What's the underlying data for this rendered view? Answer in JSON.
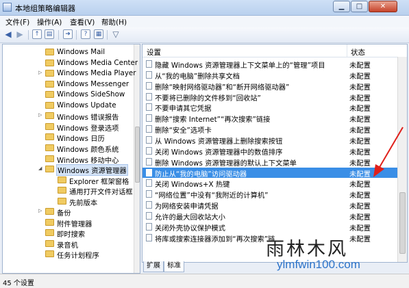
{
  "window": {
    "title": "本地组策略编辑器"
  },
  "menu": {
    "items": [
      "文件(F)",
      "操作(A)",
      "查看(V)",
      "帮助(H)"
    ]
  },
  "tree": {
    "items": [
      {
        "label": "Windows Mail",
        "level": 1,
        "arrow": ""
      },
      {
        "label": "Windows Media Center",
        "level": 1,
        "arrow": ""
      },
      {
        "label": "Windows Media Player",
        "level": 1,
        "arrow": "▷"
      },
      {
        "label": "Windows Messenger",
        "level": 1,
        "arrow": ""
      },
      {
        "label": "Windows SideShow",
        "level": 1,
        "arrow": ""
      },
      {
        "label": "Windows Update",
        "level": 1,
        "arrow": ""
      },
      {
        "label": "Windows 错误报告",
        "level": 1,
        "arrow": "▷"
      },
      {
        "label": "Windows 登录选项",
        "level": 1,
        "arrow": ""
      },
      {
        "label": "Windows 日历",
        "level": 1,
        "arrow": ""
      },
      {
        "label": "Windows 颜色系统",
        "level": 1,
        "arrow": ""
      },
      {
        "label": "Windows 移动中心",
        "level": 1,
        "arrow": ""
      },
      {
        "label": "Windows 资源管理器",
        "level": 1,
        "arrow": "◢",
        "selected": true
      },
      {
        "label": "Explorer 框架窗格",
        "level": 2,
        "arrow": ""
      },
      {
        "label": "通用打开文件对话框",
        "level": 2,
        "arrow": ""
      },
      {
        "label": "先前版本",
        "level": 2,
        "arrow": ""
      },
      {
        "label": "备份",
        "level": 1,
        "arrow": "▷"
      },
      {
        "label": "附件管理器",
        "level": 1,
        "arrow": ""
      },
      {
        "label": "即时搜索",
        "level": 1,
        "arrow": ""
      },
      {
        "label": "录音机",
        "level": 1,
        "arrow": ""
      },
      {
        "label": "任务计划程序",
        "level": 1,
        "arrow": ""
      }
    ]
  },
  "list": {
    "header_setting": "设置",
    "header_state": "状态",
    "rows": [
      {
        "name": "隐藏 Windows 资源管理器上下文菜单上的“管理”项目",
        "state": "未配置"
      },
      {
        "name": "从“我的电脑”删除共享文档",
        "state": "未配置"
      },
      {
        "name": "删除“映射网络驱动器”和“断开网络驱动器”",
        "state": "未配置"
      },
      {
        "name": "不要将已删除的文件移到“回收站”",
        "state": "未配置"
      },
      {
        "name": "不要申请其它凭据",
        "state": "未配置"
      },
      {
        "name": "删除“搜索 Internet”“再次搜索”链接",
        "state": "未配置"
      },
      {
        "name": "删除“安全”选项卡",
        "state": "未配置"
      },
      {
        "name": "从 Windows 资源管理器上删除搜索按钮",
        "state": "未配置"
      },
      {
        "name": "关闭 Windows 资源管理器中的数值排序",
        "state": "未配置"
      },
      {
        "name": "删除 Windows 资源管理器的默认上下文菜单",
        "state": "未配置"
      },
      {
        "name": "防止从“我的电脑”访问驱动器",
        "state": "未配置",
        "selected": true
      },
      {
        "name": "关闭 Windows+X 热键",
        "state": "未配置"
      },
      {
        "name": "“网络位置”中没有“我附近的计算机”",
        "state": "未配置"
      },
      {
        "name": "为网络安装申请凭据",
        "state": "未配置"
      },
      {
        "name": "允许的最大回收站大小",
        "state": "未配置"
      },
      {
        "name": "关闭外壳协议保护模式",
        "state": "未配置"
      },
      {
        "name": "将库或搜索连接器添加到“再次搜索”链",
        "state": "未配置"
      }
    ]
  },
  "tabs": {
    "expand": "扩展",
    "standard": "标准"
  },
  "status": {
    "text": "45 个设置"
  },
  "watermark": {
    "cn": "雨林木风",
    "url": "ylmfwin100.com"
  },
  "colors": {
    "selection": "#3a8ee6",
    "annotation_arrow": "#e0201b",
    "watermark_url": "#2c73c9"
  }
}
